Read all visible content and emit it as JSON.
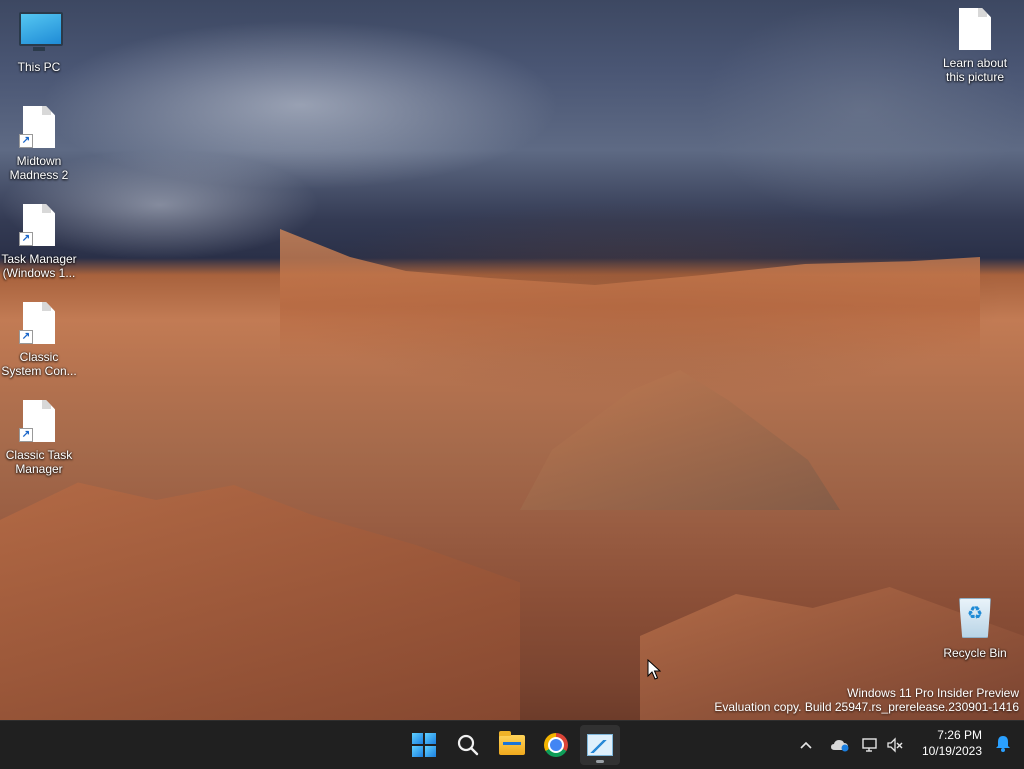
{
  "desktop": {
    "icons": [
      {
        "label": "This PC"
      },
      {
        "label": "Midtown Madness 2"
      },
      {
        "label": "Task Manager (Windows 1..."
      },
      {
        "label": "Classic System Con..."
      },
      {
        "label": "Classic Task Manager"
      },
      {
        "label": "Learn about this picture"
      },
      {
        "label": "Recycle Bin"
      }
    ],
    "shortcut_arrow": "↗",
    "recycle_glyph": "♻"
  },
  "watermark": {
    "line1": "Windows 11 Pro Insider Preview",
    "line2": "Evaluation copy. Build 25947.rs_prerelease.230901-1416"
  },
  "taskbar": {
    "pinned": [
      {
        "name": "start",
        "icon": "windows-logo-icon"
      },
      {
        "name": "search",
        "icon": "search-icon"
      },
      {
        "name": "file-explorer",
        "icon": "folder-icon"
      },
      {
        "name": "chrome",
        "icon": "chrome-icon"
      },
      {
        "name": "task-manager",
        "icon": "task-manager-icon",
        "active": true
      }
    ],
    "tray": {
      "chevron": "^",
      "onedrive": "☁",
      "network": "🖥",
      "volume": "🔇",
      "time": "7:26 PM",
      "date": "10/19/2023",
      "bell": "🔔"
    }
  },
  "colors": {
    "taskbar_bg": "#202020",
    "accent": "#1b7fe0"
  }
}
